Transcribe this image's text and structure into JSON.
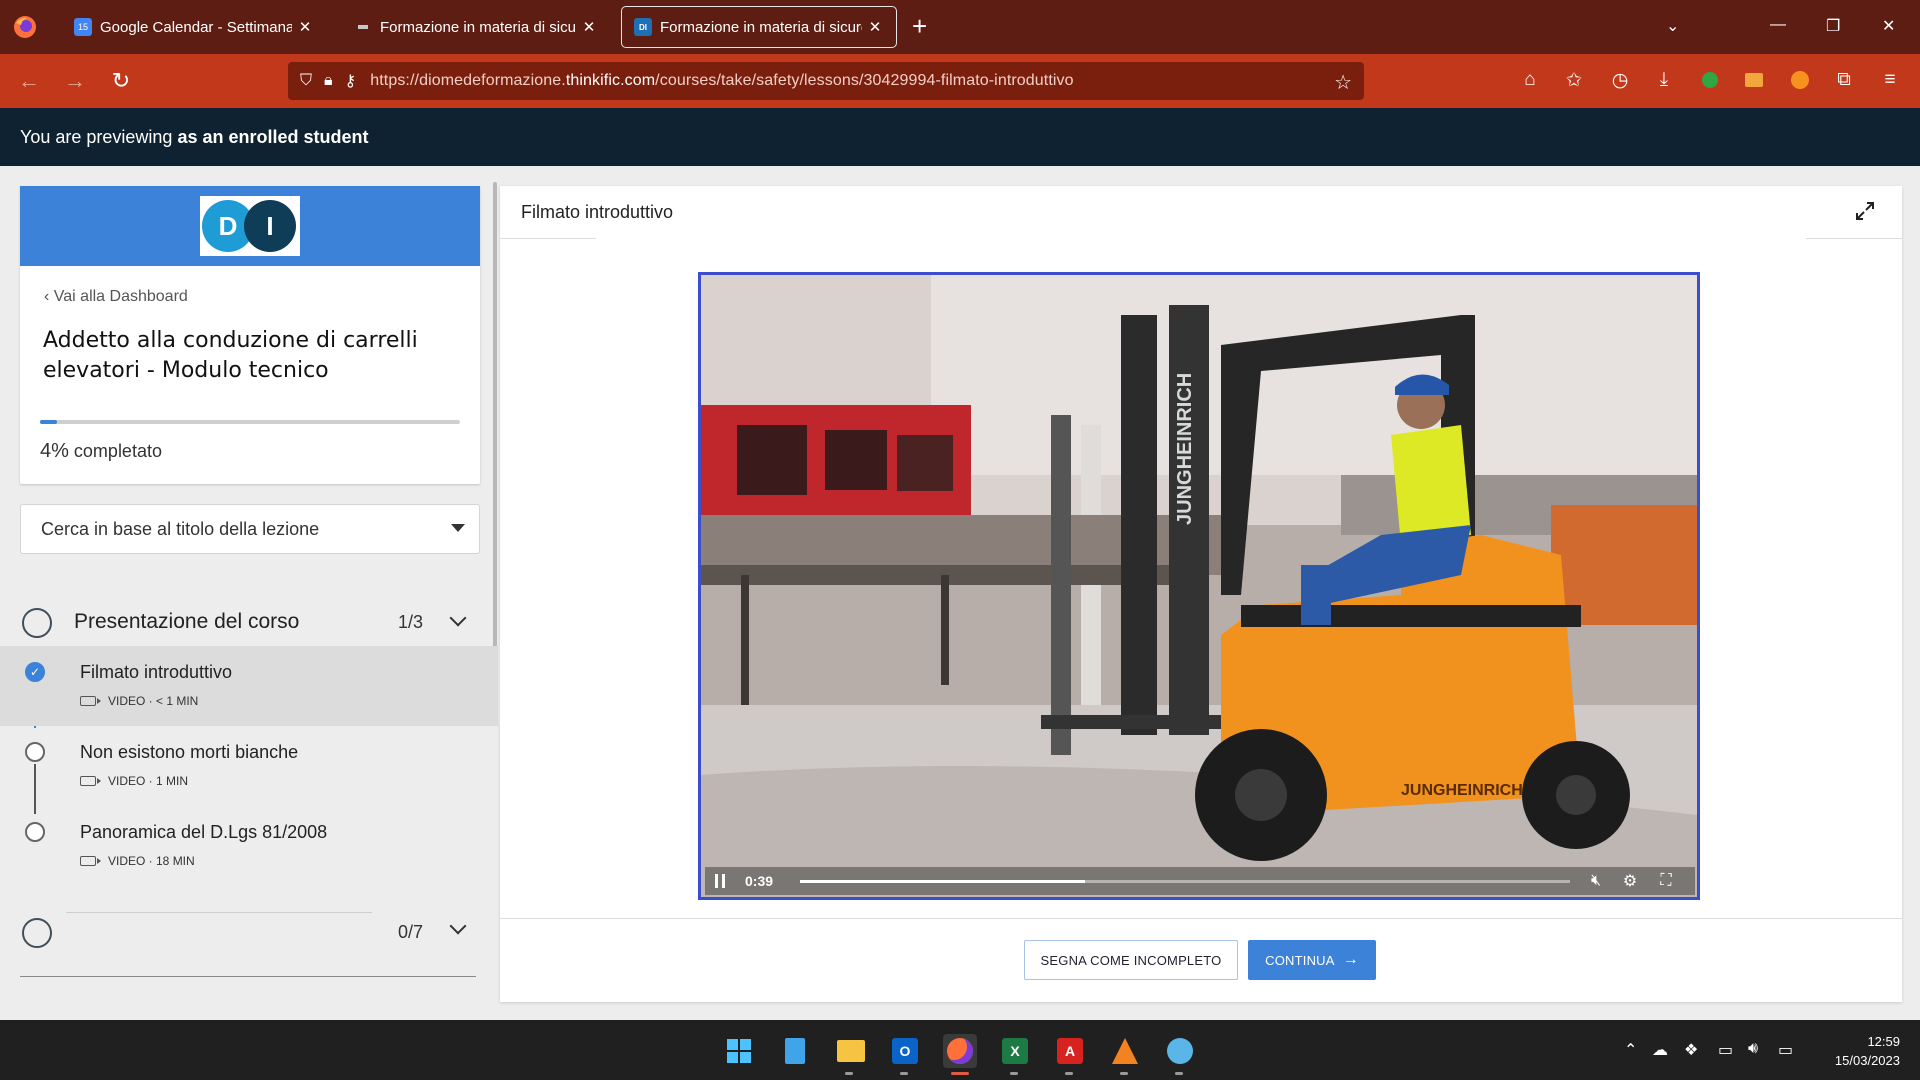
{
  "browser": {
    "tabs": [
      {
        "title": "Google Calendar - Settimana de",
        "icon": "google-calendar-icon",
        "favicon_text": "15"
      },
      {
        "title": "Formazione in materia di sicurez",
        "icon": "thinkific-icon"
      },
      {
        "title": "Formazione in materia di sicurez",
        "icon": "thinkific-icon",
        "favicon_text": "DI"
      }
    ],
    "url_prefix": "https://diomedeformazione.",
    "url_domain": "thinkific.com",
    "url_path": "/courses/take/safety/lessons/30429994-filmato-introduttivo",
    "chrome_color": "#5e1d12",
    "toolbar_color": "#c2381a"
  },
  "preview_banner": {
    "text": "You are previewing",
    "bold": "as an enrolled student"
  },
  "sidebar": {
    "back_link": "Vai alla Dashboard",
    "course_title": "Addetto alla conduzione di carrelli elevatori - Modulo tecnico",
    "progress_percent": 4,
    "progress_pct_label": "4%",
    "progress_suffix": "completato",
    "logo_letters": [
      "D",
      "I"
    ],
    "search_placeholder": "Cerca in base al titolo della lezione",
    "sections": [
      {
        "title": "Presentazione del corso",
        "count": "1/3",
        "lessons": [
          {
            "title": "Filmato introduttivo",
            "meta": "VIDEO · < 1 MIN",
            "completed": true,
            "active": true
          },
          {
            "title": "Non esistono morti bianche",
            "meta": "VIDEO · 1 MIN",
            "completed": false,
            "active": false
          },
          {
            "title": "Panoramica del D.Lgs 81/2008",
            "meta": "VIDEO · 18 MIN",
            "completed": false,
            "active": false
          }
        ]
      },
      {
        "title": "",
        "count": "0/7"
      }
    ]
  },
  "content": {
    "lesson_title": "Filmato introduttivo",
    "video": {
      "time": "0:39",
      "progress_fraction": 0.37,
      "buffered_fraction": 0.45,
      "forklift_brand": "JUNGHEINRICH"
    },
    "btn_incomplete": "SEGNA COME INCOMPLETO",
    "btn_continue": "CONTINUA",
    "accent_color": "#3b82d8"
  },
  "taskbar": {
    "apps": [
      "windows-start-icon",
      "notepad-icon",
      "file-explorer-icon",
      "outlook-icon",
      "firefox-icon",
      "excel-icon",
      "acrobat-icon",
      "vlc-icon",
      "paint-icon"
    ],
    "time": "12:59",
    "date": "15/03/2023"
  }
}
